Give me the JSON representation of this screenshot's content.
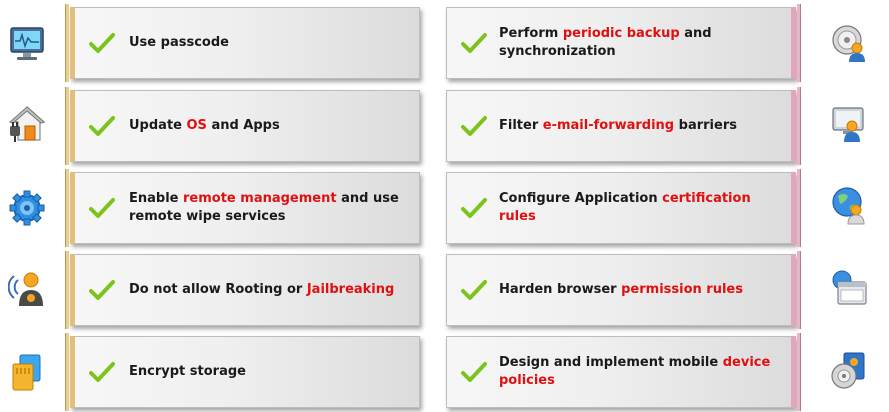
{
  "left_items": [
    {
      "parts": [
        {
          "t": "Use passcode",
          "hl": false
        }
      ],
      "icon": "monitor-icon"
    },
    {
      "parts": [
        {
          "t": "Update ",
          "hl": false
        },
        {
          "t": "OS",
          "hl": true
        },
        {
          "t": " and Apps",
          "hl": false
        }
      ],
      "icon": "house-plug-icon"
    },
    {
      "parts": [
        {
          "t": "Enable ",
          "hl": false
        },
        {
          "t": "remote management",
          "hl": true
        },
        {
          "t": " and use remote wipe services",
          "hl": false
        }
      ],
      "icon": "gear-icon"
    },
    {
      "parts": [
        {
          "t": "Do not allow Rooting or ",
          "hl": false
        },
        {
          "t": "Jailbreaking",
          "hl": true
        }
      ],
      "icon": "user-signal-icon"
    },
    {
      "parts": [
        {
          "t": "Encrypt storage",
          "hl": false
        }
      ],
      "icon": "storage-icon"
    }
  ],
  "right_items": [
    {
      "parts": [
        {
          "t": "Perform ",
          "hl": false
        },
        {
          "t": "periodic backup",
          "hl": true
        },
        {
          "t": " and synchronization",
          "hl": false
        }
      ],
      "icon": "backup-user-icon"
    },
    {
      "parts": [
        {
          "t": "Filter ",
          "hl": false
        },
        {
          "t": "e-mail-forwarding",
          "hl": true
        },
        {
          "t": " barriers",
          "hl": false
        }
      ],
      "icon": "computer-user-icon"
    },
    {
      "parts": [
        {
          "t": "Configure Application ",
          "hl": false
        },
        {
          "t": "certification rules",
          "hl": true
        }
      ],
      "icon": "globe-user-icon"
    },
    {
      "parts": [
        {
          "t": "Harden browser ",
          "hl": false
        },
        {
          "t": "permission rules",
          "hl": true
        }
      ],
      "icon": "browser-window-icon"
    },
    {
      "parts": [
        {
          "t": "Design and implement mobile ",
          "hl": false
        },
        {
          "t": "device policies",
          "hl": true
        }
      ],
      "icon": "policy-disc-icon"
    }
  ],
  "colors": {
    "highlight": "#e01010",
    "check": "#7cc41c",
    "left_accent": "#e2c07a",
    "right_accent": "#e6a3be"
  }
}
